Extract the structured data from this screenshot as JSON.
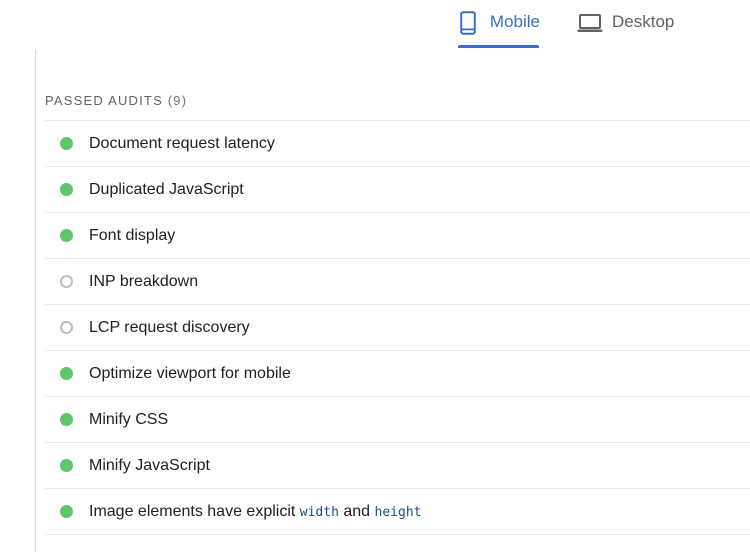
{
  "tabs": {
    "mobile": {
      "label": "Mobile",
      "icon": "smartphone-icon",
      "selected": true
    },
    "desktop": {
      "label": "Desktop",
      "icon": "laptop-icon",
      "selected": false
    }
  },
  "section": {
    "title": "PASSED AUDITS",
    "count": "(9)"
  },
  "audits": [
    {
      "title": "Document request latency",
      "status": "pass"
    },
    {
      "title": "Duplicated JavaScript",
      "status": "pass"
    },
    {
      "title": "Font display",
      "status": "pass"
    },
    {
      "title": "INP breakdown",
      "status": "informative"
    },
    {
      "title": "LCP request discovery",
      "status": "informative"
    },
    {
      "title": "Optimize viewport for mobile",
      "status": "pass"
    },
    {
      "title": "Minify CSS",
      "status": "pass"
    },
    {
      "title": "Minify JavaScript",
      "status": "pass"
    },
    {
      "title_prefix": "Image elements have explicit ",
      "code1": "width",
      "title_middle": " and ",
      "code2": "height",
      "status": "pass"
    }
  ],
  "colors": {
    "accent": "#3a6fc4",
    "pass": "#5ec66b",
    "informative": "#bdbdbd",
    "divider": "#e8eaed"
  }
}
